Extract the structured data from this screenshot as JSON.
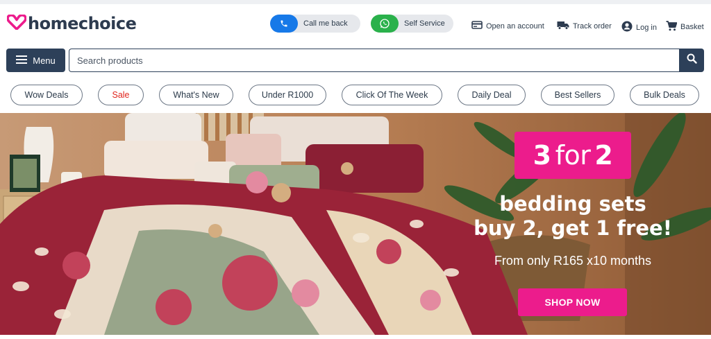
{
  "brand": {
    "logo_text": "homechoice",
    "accent": "#ec1c8c",
    "navy": "#2d4059"
  },
  "header": {
    "call_me_back": "Call me back",
    "self_service": "Self Service",
    "open_account": "Open an account",
    "track_order": "Track order",
    "log_in": "Log in",
    "basket": "Basket"
  },
  "search": {
    "menu_label": "Menu",
    "placeholder": "Search products"
  },
  "categories": [
    "Wow Deals",
    "Sale",
    "What's New",
    "Under R1000",
    "Click Of The Week",
    "Daily Deal",
    "Best Sellers",
    "Bulk Deals"
  ],
  "hero": {
    "badge_num1": "3",
    "badge_word": "for",
    "badge_num2": "2",
    "headline_line1": "bedding sets",
    "headline_line2": "buy 2, get 1 free!",
    "subtext": "From only R165 x10 months",
    "cta": "SHOP NOW"
  },
  "icons": [
    "heart-logo-icon",
    "phone-icon",
    "whatsapp-icon",
    "id-card-icon",
    "truck-icon",
    "user-icon",
    "cart-icon",
    "hamburger-icon",
    "search-icon"
  ]
}
